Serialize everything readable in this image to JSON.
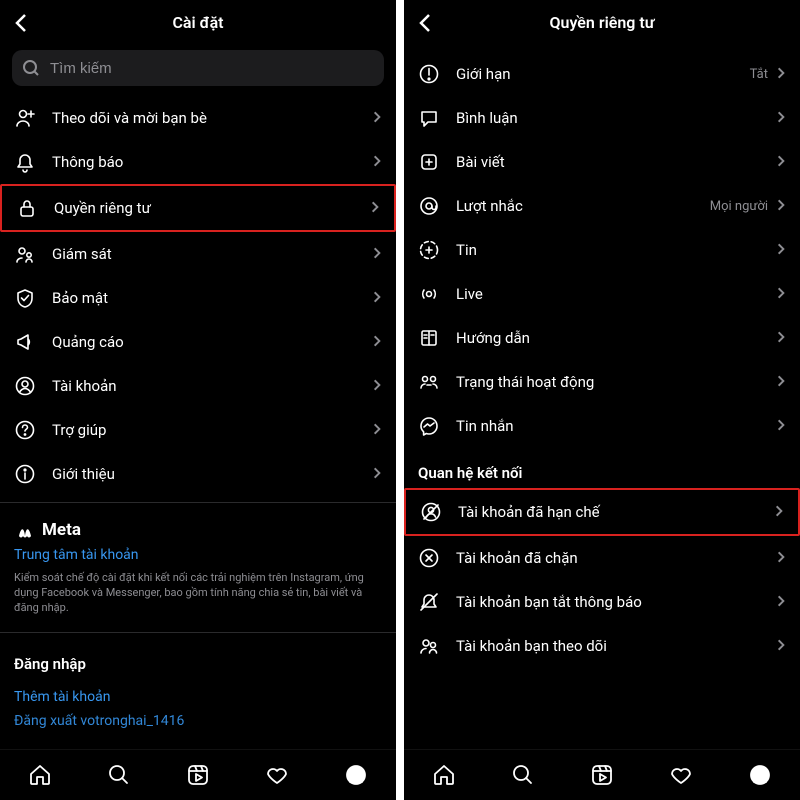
{
  "left": {
    "title": "Cài đặt",
    "search_placeholder": "Tìm kiếm",
    "items": [
      {
        "label": "Theo dõi và mời bạn bè",
        "icon": "follow"
      },
      {
        "label": "Thông báo",
        "icon": "bell"
      },
      {
        "label": "Quyền riêng tư",
        "icon": "lock",
        "highlight": true
      },
      {
        "label": "Giám sát",
        "icon": "supervise"
      },
      {
        "label": "Bảo mật",
        "icon": "shield"
      },
      {
        "label": "Quảng cáo",
        "icon": "ads"
      },
      {
        "label": "Tài khoản",
        "icon": "account"
      },
      {
        "label": "Trợ giúp",
        "icon": "help"
      },
      {
        "label": "Giới thiệu",
        "icon": "info"
      }
    ],
    "meta_brand": "Meta",
    "meta_link": "Trung tâm tài khoản",
    "meta_desc": "Kiểm soát chế độ cài đặt khi kết nối các trải nghiệm trên Instagram, ứng dụng Facebook và Messenger, bao gồm tính năng chia sẻ tin, bài viết và đăng nhập.",
    "login_heading": "Đăng nhập",
    "add_account": "Thêm tài khoản",
    "logout": "Đăng xuất votronghai_1416"
  },
  "right": {
    "title": "Quyền riêng tư",
    "items": [
      {
        "label": "Giới hạn",
        "icon": "limits",
        "value": "Tắt"
      },
      {
        "label": "Bình luận",
        "icon": "comment"
      },
      {
        "label": "Bài viết",
        "icon": "post"
      },
      {
        "label": "Lượt nhắc",
        "icon": "mention",
        "value": "Mọi người"
      },
      {
        "label": "Tin",
        "icon": "story"
      },
      {
        "label": "Live",
        "icon": "live"
      },
      {
        "label": "Hướng dẫn",
        "icon": "guides"
      },
      {
        "label": "Trạng thái hoạt động",
        "icon": "activity"
      },
      {
        "label": "Tin nhắn",
        "icon": "messenger"
      }
    ],
    "section2": "Quan hệ kết nối",
    "items2": [
      {
        "label": "Tài khoản đã hạn chế",
        "icon": "restricted",
        "highlight": true
      },
      {
        "label": "Tài khoản đã chặn",
        "icon": "blocked"
      },
      {
        "label": "Tài khoản bạn tắt thông báo",
        "icon": "muted"
      },
      {
        "label": "Tài khoản bạn theo dõi",
        "icon": "following"
      }
    ]
  }
}
